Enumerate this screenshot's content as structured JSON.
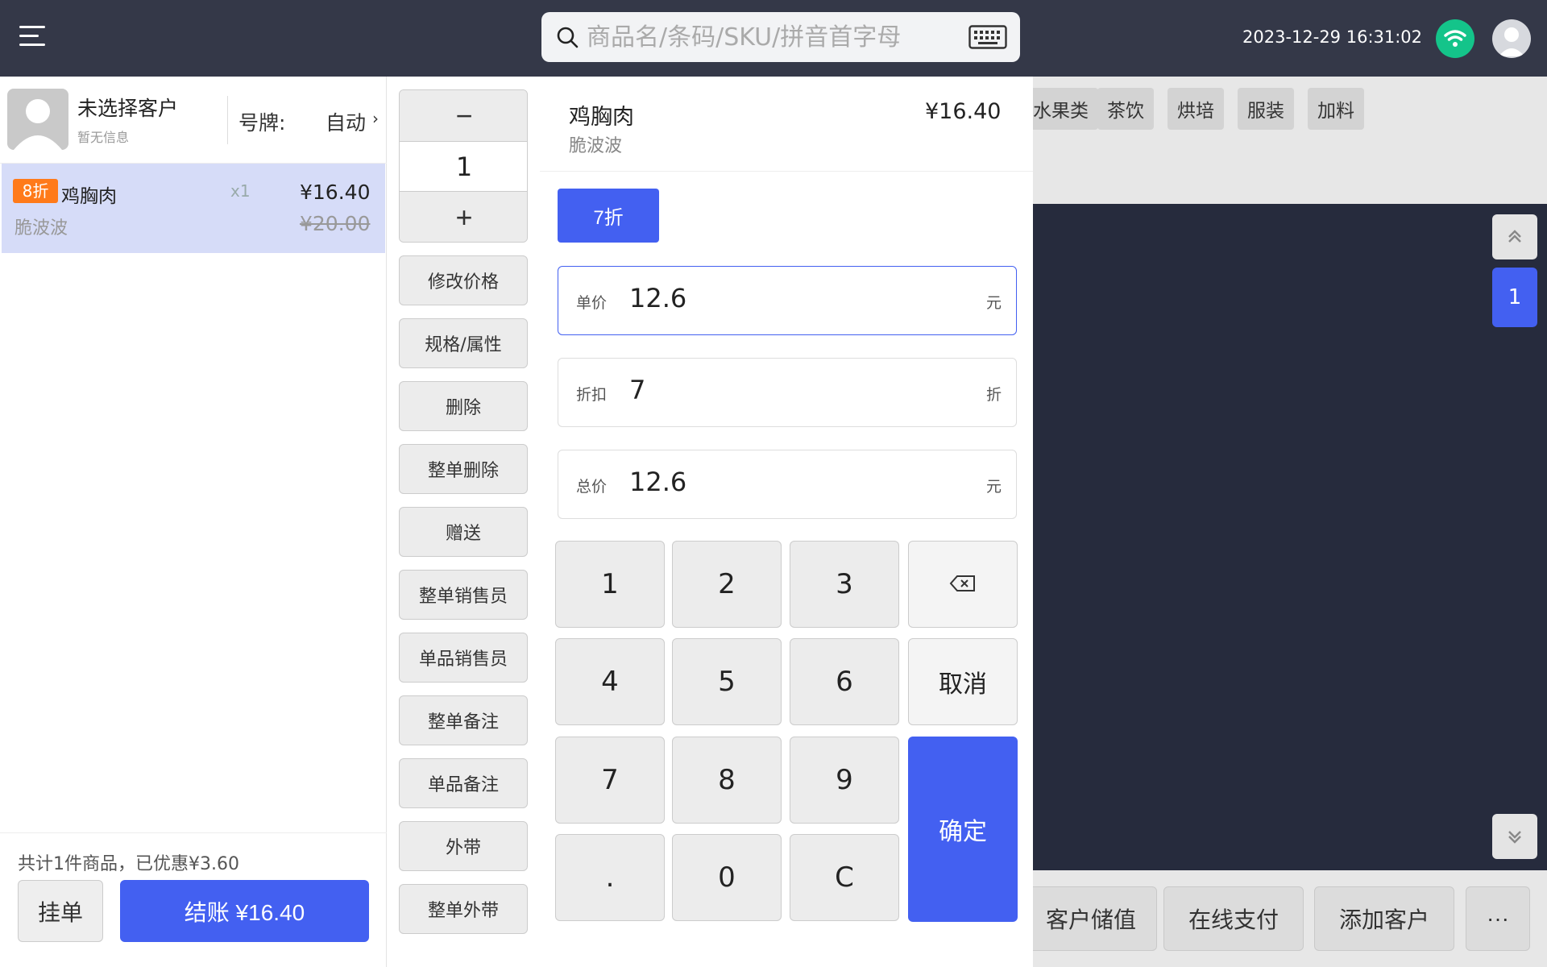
{
  "topbar": {
    "search_placeholder": "商品名/条码/SKU/拼音首字母",
    "datetime": "2023-12-29 16:31:02"
  },
  "customer": {
    "name": "未选择客户",
    "info": "暂无信息",
    "plate_label": "号牌:",
    "plate_value": "自动",
    "plate_arrow": "›"
  },
  "cart": {
    "items": [
      {
        "badge": "8折",
        "name": "鸡胸肉",
        "qty": "x1",
        "price": "¥16.40",
        "spec": "脆波波",
        "original_price": "¥20.00"
      }
    ],
    "summary": "共计1件商品，已优惠¥3.60",
    "hold_label": "挂单",
    "checkout_label": "结账 ¥16.40"
  },
  "stepper": {
    "minus": "−",
    "value": "1",
    "plus": "+"
  },
  "actions": [
    "修改价格",
    "规格/属性",
    "删除",
    "整单删除",
    "赠送",
    "整单销售员",
    "单品销售员",
    "整单备注",
    "单品备注",
    "外带",
    "整单外带"
  ],
  "categories": [
    "水果类",
    "茶饮",
    "烘培",
    "服装",
    "加料"
  ],
  "pager": {
    "current": "1"
  },
  "bottom_actions": [
    "客户储值",
    "在线支付",
    "添加客户",
    "···"
  ],
  "dialog": {
    "product_name": "鸡胸肉",
    "product_spec": "脆波波",
    "product_price": "¥16.40",
    "preset_discount": "7折",
    "unit_price": {
      "label": "单价",
      "value": "12.6",
      "unit": "元"
    },
    "discount": {
      "label": "折扣",
      "value": "7",
      "unit": "折"
    },
    "total_price": {
      "label": "总价",
      "value": "12.6",
      "unit": "元"
    },
    "keys": [
      "1",
      "2",
      "3",
      "4",
      "5",
      "6",
      "7",
      "8",
      "9",
      ".",
      "0",
      "C"
    ],
    "cancel_label": "取消",
    "confirm_label": "确定"
  },
  "colors": {
    "accent": "#4360f1",
    "badge": "#ff7a1a",
    "wifi": "#14c48a",
    "topbar": "#343848"
  }
}
